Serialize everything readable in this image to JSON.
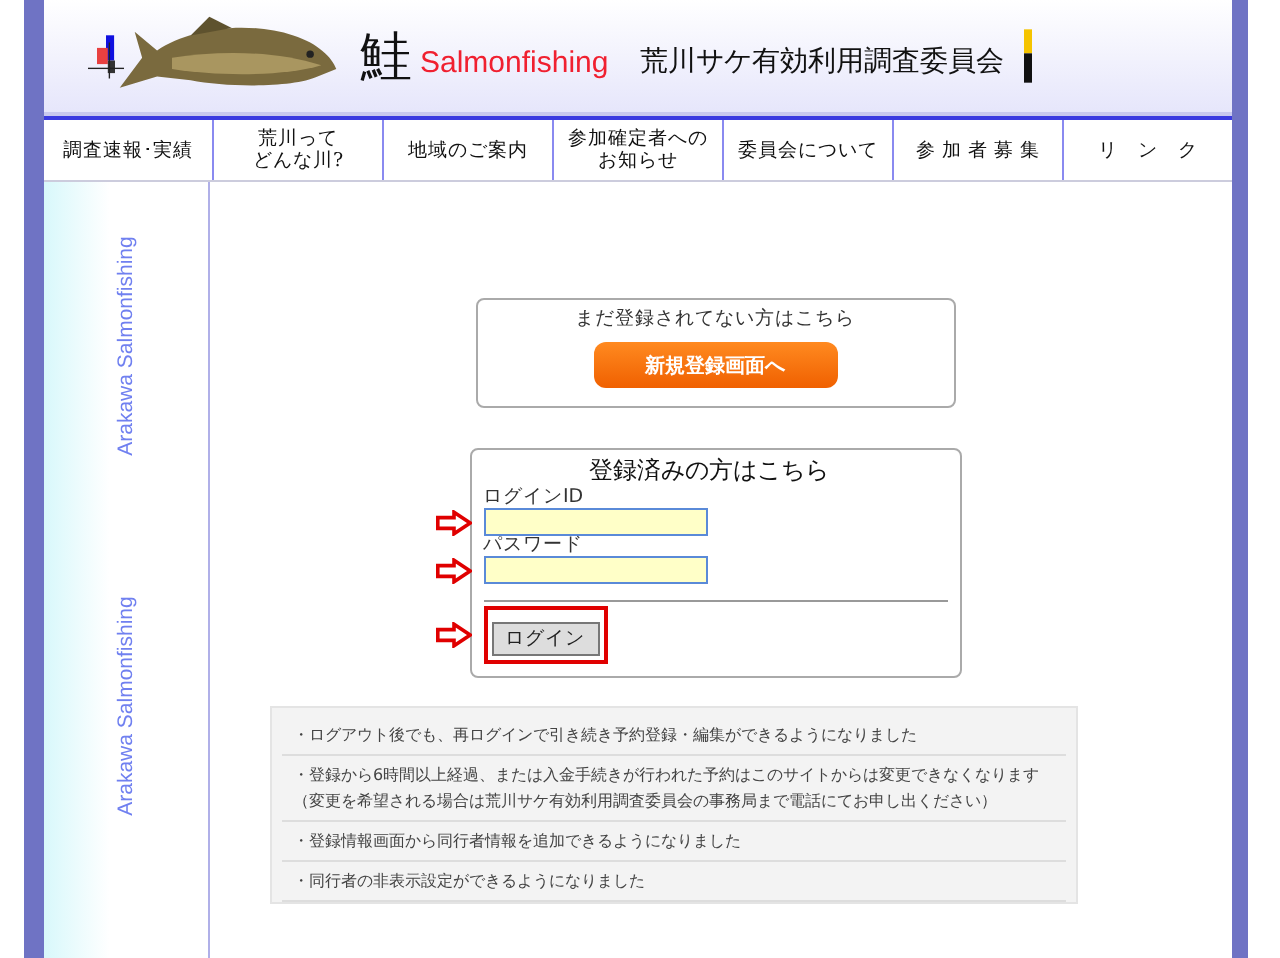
{
  "header": {
    "kanji": "鮭",
    "brand": "Salmonfishing",
    "organization": "荒川サケ有効利用調査委員会"
  },
  "nav": [
    {
      "lines": [
        "調査速報･実績"
      ]
    },
    {
      "lines": [
        "荒川って",
        "どんな川?"
      ]
    },
    {
      "lines": [
        "地域のご案内"
      ]
    },
    {
      "lines": [
        "参加確定者への",
        "お知らせ"
      ]
    },
    {
      "lines": [
        "委員会について"
      ]
    },
    {
      "lines": [
        "参 加 者 募 集"
      ]
    },
    {
      "lines": [
        "リ　ン　ク"
      ]
    }
  ],
  "sidebar": {
    "labels": [
      "Arakawa Salmonfishing",
      "Arakawa Salmonfishing"
    ]
  },
  "signup": {
    "prompt": "まだ登録されてない方はこちら",
    "button": "新規登録画面へ"
  },
  "login": {
    "title": "登録済みの方はこちら",
    "id_label": "ログインID",
    "password_label": "パスワード",
    "button": "ログイン"
  },
  "notices": [
    "・ログアウト後でも、再ログインで引き続き予約登録・編集ができるようになりました",
    "・登録から6時間以上経過、または入金手続きが行われた予約はこのサイトからは変更できなくなります（変更を希望される場合は荒川サケ有効利用調査委員会の事務局まで電話にてお申し出ください）",
    "・登録情報画面から同行者情報を追加できるようになりました",
    "・同行者の非表示設定ができるようになりました"
  ]
}
